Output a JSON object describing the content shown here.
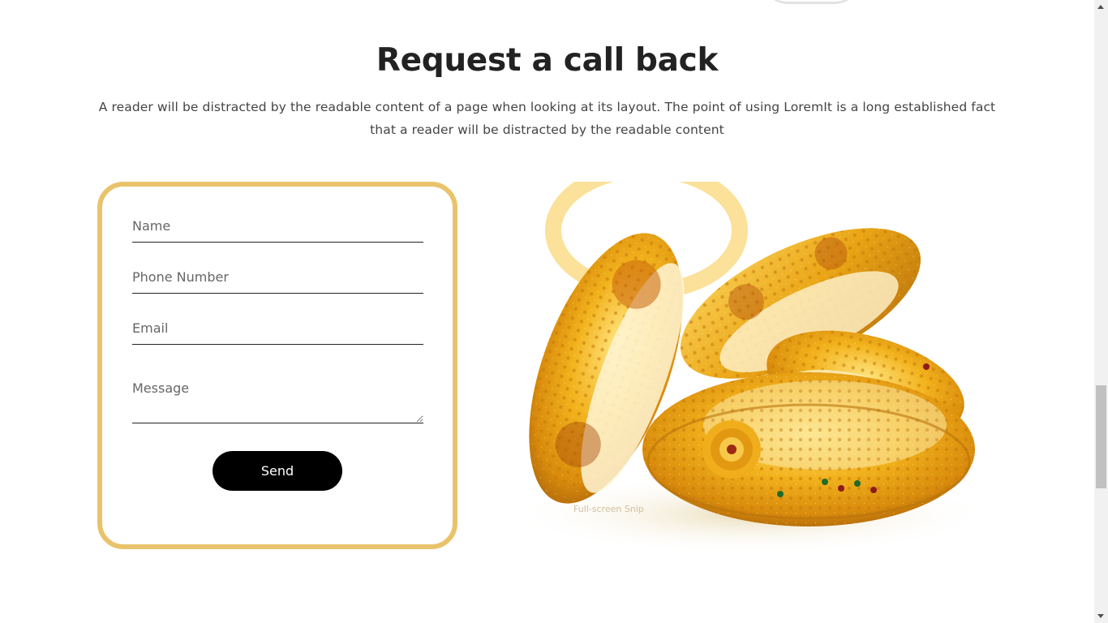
{
  "callback": {
    "title": "Request a call back",
    "description": "A reader will be distracted by the readable content of a page when looking at its layout. The point of using LoremIt is a long established fact that a reader will be distracted by the readable content"
  },
  "form": {
    "name_placeholder": "Name",
    "phone_placeholder": "Phone Number",
    "email_placeholder": "Email",
    "message_placeholder": "Message",
    "send_label": "Send"
  },
  "image": {
    "subject": "gold-bangles-photo",
    "overlay_text": "Full-screen Snip"
  },
  "colors": {
    "accent_border": "#e9c36b",
    "button_bg": "#000000",
    "heading": "#222222"
  },
  "scrollbar": {
    "position": 0.62
  }
}
